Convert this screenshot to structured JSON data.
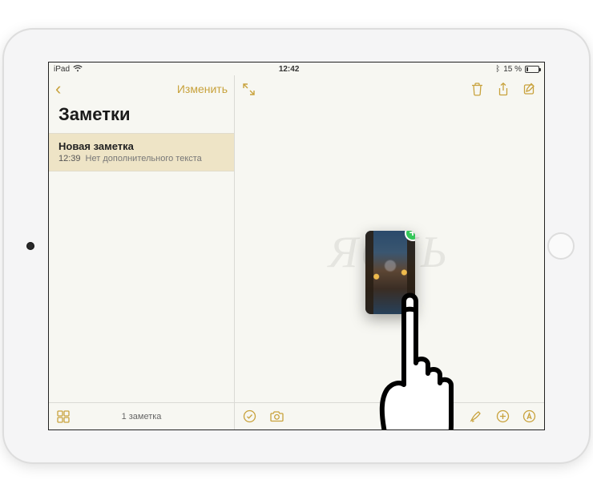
{
  "status": {
    "device": "iPad",
    "time": "12:42",
    "bluetooth": "ᛒ",
    "battery_text": "15 %",
    "battery_level": 15
  },
  "sidebar": {
    "edit_label": "Изменить",
    "title": "Заметки",
    "note": {
      "title": "Новая заметка",
      "time": "12:39",
      "preview": "Нет дополнительного текста"
    },
    "count_label": "1 заметка"
  },
  "drag": {
    "badge": "+"
  },
  "watermark": "ЯбЛЬ",
  "colors": {
    "accent": "#c8a23c",
    "badge": "#34c759"
  }
}
